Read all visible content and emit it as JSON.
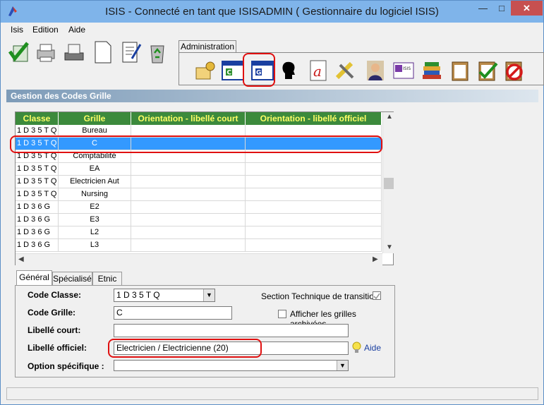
{
  "window": {
    "title": "ISIS - Connecté en tant que ISISADMIN ( Gestionnaire du logiciel ISIS)"
  },
  "menu": {
    "items": [
      "Isis",
      "Edition",
      "Aide"
    ]
  },
  "toolbar": {
    "admin_tab_label": "Administration"
  },
  "section": {
    "title": "Gestion des Codes Grille"
  },
  "grid": {
    "headers": [
      "Classe",
      "Grille",
      "Orientation - libellé court",
      "Orientation - libellé officiel"
    ],
    "rows": [
      [
        "1 D 3 5 T Q",
        "Bureau",
        "",
        ""
      ],
      [
        "1 D 3 5 T Q",
        "C",
        "",
        ""
      ],
      [
        "1 D 3 5 T Q",
        "Comptabilité",
        "",
        ""
      ],
      [
        "1 D 3 5 T Q",
        "EA",
        "",
        ""
      ],
      [
        "1 D 3 5 T Q",
        "Electricien Aut",
        "",
        ""
      ],
      [
        "1 D 3 5 T Q",
        "Nursing",
        "",
        ""
      ],
      [
        "1 D 3 6 G",
        "E2",
        "",
        ""
      ],
      [
        "1 D 3 6 G",
        "E3",
        "",
        ""
      ],
      [
        "1 D 3 6 G",
        "L2",
        "",
        ""
      ],
      [
        "1 D 3 6 G",
        "L3",
        "",
        ""
      ]
    ],
    "selected_row": 1
  },
  "tabs": [
    "Général",
    "Spécialisé",
    "Etnic"
  ],
  "form": {
    "code_classe_label": "Code Classe:",
    "code_classe_value": "1 D 3 5 T Q",
    "code_grille_label": "Code Grille:",
    "code_grille_value": "C",
    "libelle_court_label": "Libellé court:",
    "libelle_court_value": "",
    "libelle_officiel_label": "Libellé officiel:",
    "libelle_officiel_value": "Electricien / Electricienne (20)",
    "option_label": "Option spécifique :",
    "option_value": "",
    "section_transition_label": "Section Technique de transition",
    "afficher_archivees_label": "Afficher les grilles archivées",
    "aide_label": "Aide"
  },
  "colors": {
    "accent": "#3399ff",
    "grid_header_bg": "#3c8a3c",
    "grid_header_fg": "#ffff66",
    "highlight": "#e01010"
  }
}
